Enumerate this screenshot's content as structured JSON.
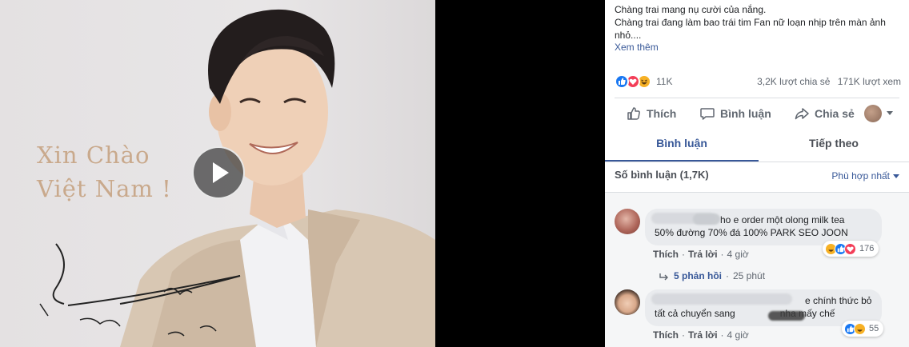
{
  "video": {
    "title_line1": "Xin Chào",
    "title_line2": "Việt Nam !"
  },
  "post": {
    "line1": "Chàng trai mang nụ cười của nắng.",
    "line2": "Chàng trai đang làm bao trái tim Fan nữ loạn nhịp trên màn ảnh",
    "line3": "nhỏ....",
    "see_more": "Xem thêm"
  },
  "stats": {
    "reaction_count": "11K",
    "shares": "3,2K lượt chia sẻ",
    "views": "171K lượt xem",
    "reactions": [
      "like",
      "love",
      "haha"
    ]
  },
  "actions": {
    "like": "Thích",
    "comment": "Bình luận",
    "share": "Chia sẻ"
  },
  "tabs": {
    "comments": "Bình luận",
    "next": "Tiếp theo"
  },
  "comments_header": {
    "count": "Số bình luận (1,7K)",
    "sort": "Phù hợp nhất"
  },
  "comments": [
    {
      "line1": "ho e order một olong milk tea",
      "line2": "50% đường 70% đá 100% PARK SEO JOON",
      "like": "Thích",
      "reply": "Trả lời",
      "time": "4 giờ",
      "reactions": [
        "haha",
        "like",
        "love"
      ],
      "reaction_count": "176",
      "replies": "5 phản hồi",
      "replies_time": "25 phút"
    },
    {
      "line1": "e chính thức bỏ",
      "line2a": "tất cả chuyển sang",
      "line2b": "nha mấy chế",
      "like": "Thích",
      "reply": "Trả lời",
      "time": "4 giờ",
      "reactions": [
        "like",
        "haha"
      ],
      "reaction_count": "55"
    }
  ],
  "colors": {
    "link": "#385898",
    "like_blue": "#1877f2",
    "love_red": "#f33e58",
    "haha_yellow": "#f7b125"
  }
}
